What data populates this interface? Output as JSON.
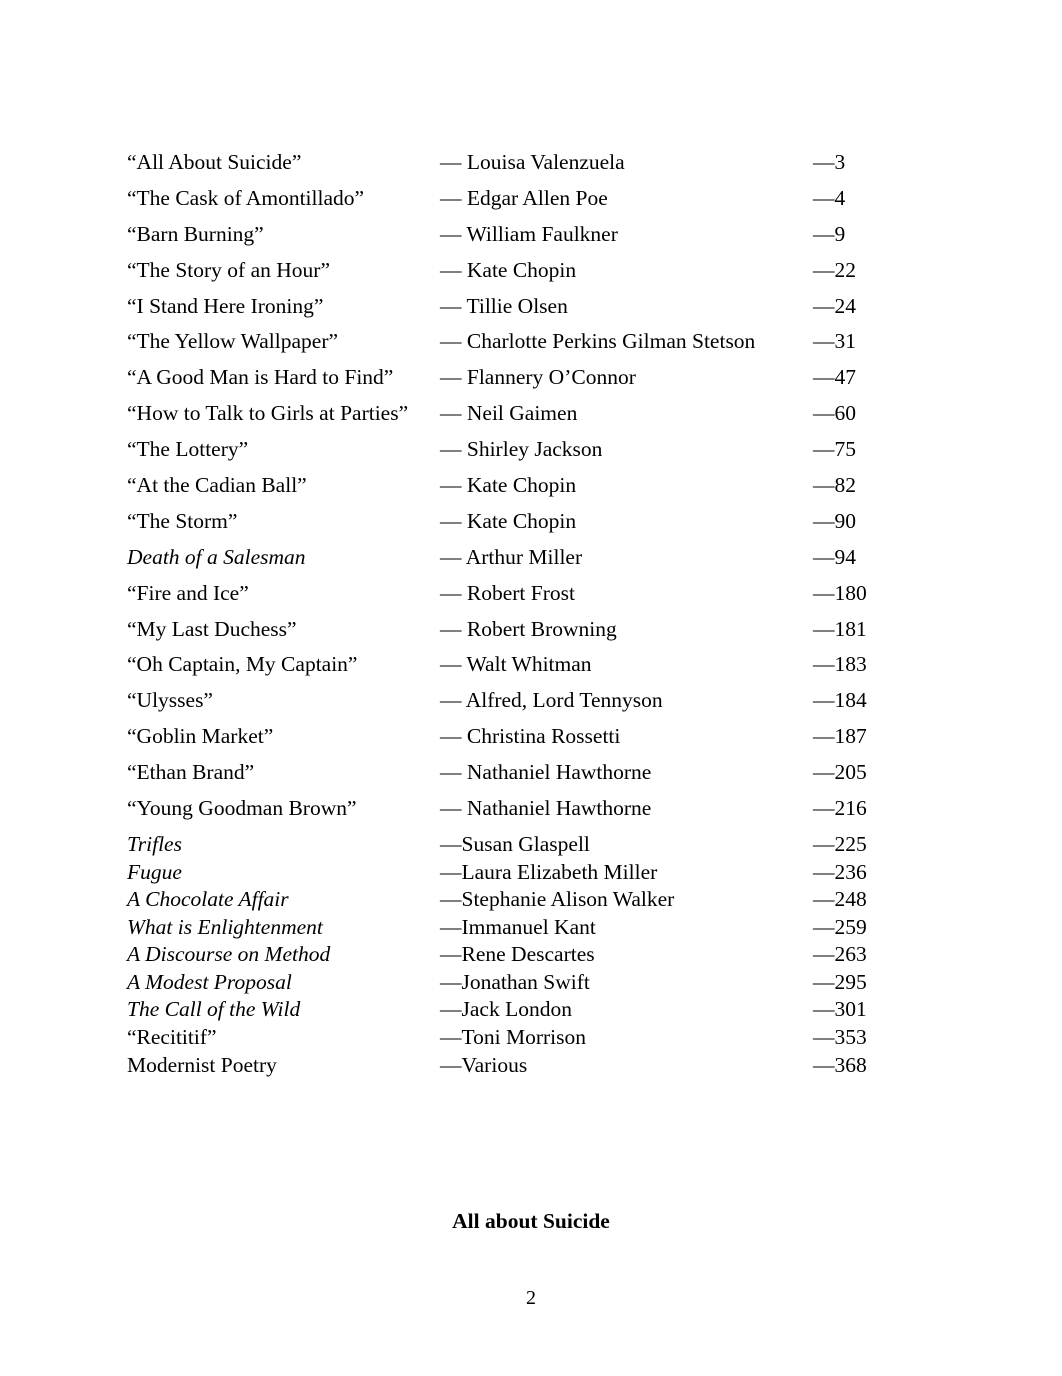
{
  "document": {
    "section_heading": "All about Suicide",
    "page_number": "2"
  },
  "toc": {
    "entries": [
      {
        "title": "“All About Suicide”",
        "title_style": "roman",
        "author": "— Louisa Valenzuela",
        "page": "—3",
        "spacing": "loose"
      },
      {
        "title": "“The Cask of Amontillado”",
        "title_style": "roman",
        "author": "— Edgar Allen Poe",
        "page": "—4",
        "spacing": "loose"
      },
      {
        "title": "“Barn Burning”",
        "title_style": "roman",
        "author": "— William Faulkner",
        "page": "—9",
        "spacing": "loose"
      },
      {
        "title": "“The Story of an Hour”",
        "title_style": "roman",
        "author": "— Kate Chopin",
        "page": "—22",
        "spacing": "loose"
      },
      {
        "title": "“I Stand Here Ironing”",
        "title_style": "roman",
        "author": "— Tillie Olsen",
        "page": "—24",
        "spacing": "loose"
      },
      {
        "title": "“The Yellow Wallpaper”",
        "title_style": "roman",
        "author": "— Charlotte Perkins Gilman Stetson",
        "page": "—31",
        "spacing": "loose"
      },
      {
        "title": "“A Good Man is Hard to Find”",
        "title_style": "roman",
        "author": "— Flannery O’Connor",
        "page": "—47",
        "spacing": "loose"
      },
      {
        "title": "“How to Talk to Girls at Parties”",
        "title_style": "roman",
        "author": "— Neil Gaimen",
        "page": "—60",
        "spacing": "loose"
      },
      {
        "title": "“The Lottery”",
        "title_style": "roman",
        "author": "— Shirley Jackson",
        "page": "—75",
        "spacing": "loose"
      },
      {
        "title": "“At the Cadian Ball”",
        "title_style": "roman",
        "author": "— Kate Chopin",
        "page": "—82",
        "spacing": "loose"
      },
      {
        "title": "“The Storm”",
        "title_style": "roman",
        "author": "— Kate Chopin",
        "page": "—90",
        "spacing": "loose"
      },
      {
        "title": "Death of a Salesman",
        "title_style": "italic",
        "author": "— Arthur Miller",
        "page": "—94",
        "spacing": "loose"
      },
      {
        "title": "“Fire and Ice”",
        "title_style": "roman",
        "author": "— Robert Frost",
        "page": "—180",
        "spacing": "loose"
      },
      {
        "title": "“My Last Duchess”",
        "title_style": "roman",
        "author": "— Robert Browning",
        "page": "—181",
        "spacing": "loose"
      },
      {
        "title": "“Oh Captain, My Captain”",
        "title_style": "roman",
        "author": "— Walt Whitman",
        "page": "—183",
        "spacing": "loose"
      },
      {
        "title": "“Ulysses”",
        "title_style": "roman",
        "author": "— Alfred, Lord Tennyson",
        "page": "—184",
        "spacing": "loose"
      },
      {
        "title": "“Goblin Market”",
        "title_style": "roman",
        "author": "— Christina Rossetti",
        "page": "—187",
        "spacing": "loose"
      },
      {
        "title": "“Ethan Brand”",
        "title_style": "roman",
        "author": "— Nathaniel Hawthorne",
        "page": "—205",
        "spacing": "loose"
      },
      {
        "title": "“Young Goodman Brown”",
        "title_style": "roman",
        "author": "— Nathaniel Hawthorne",
        "page": "—216",
        "spacing": "loose"
      },
      {
        "title": "Trifles",
        "title_style": "italic",
        "author": "—Susan Glaspell",
        "page": "—225",
        "spacing": "tight"
      },
      {
        "title": "Fugue",
        "title_style": "italic",
        "author": "—Laura Elizabeth Miller",
        "page": "—236",
        "spacing": "tight"
      },
      {
        "title": "A Chocolate Affair",
        "title_style": "italic",
        "author": "—Stephanie Alison Walker",
        "page": "—248",
        "spacing": "tight"
      },
      {
        "title": "What is Enlightenment",
        "title_style": "italic",
        "author": "—Immanuel Kant",
        "page": "—259",
        "spacing": "tight"
      },
      {
        "title": "A Discourse on Method",
        "title_style": "italic",
        "author": "—Rene Descartes",
        "page": "—263",
        "spacing": "tight"
      },
      {
        "title": "A Modest Proposal",
        "title_style": "italic",
        "author": "—Jonathan Swift",
        "page": "—295",
        "spacing": "tight"
      },
      {
        "title": "The Call of the Wild",
        "title_style": "italic",
        "author": "—Jack London",
        "page": "—301",
        "spacing": "tight"
      },
      {
        "title": "“Recititif”",
        "title_style": "roman",
        "author": "—Toni Morrison",
        "page": "—353",
        "spacing": "tight"
      },
      {
        "title": "Modernist Poetry",
        "title_style": "roman",
        "author": "—Various",
        "page": "—368",
        "spacing": "tight"
      }
    ]
  }
}
